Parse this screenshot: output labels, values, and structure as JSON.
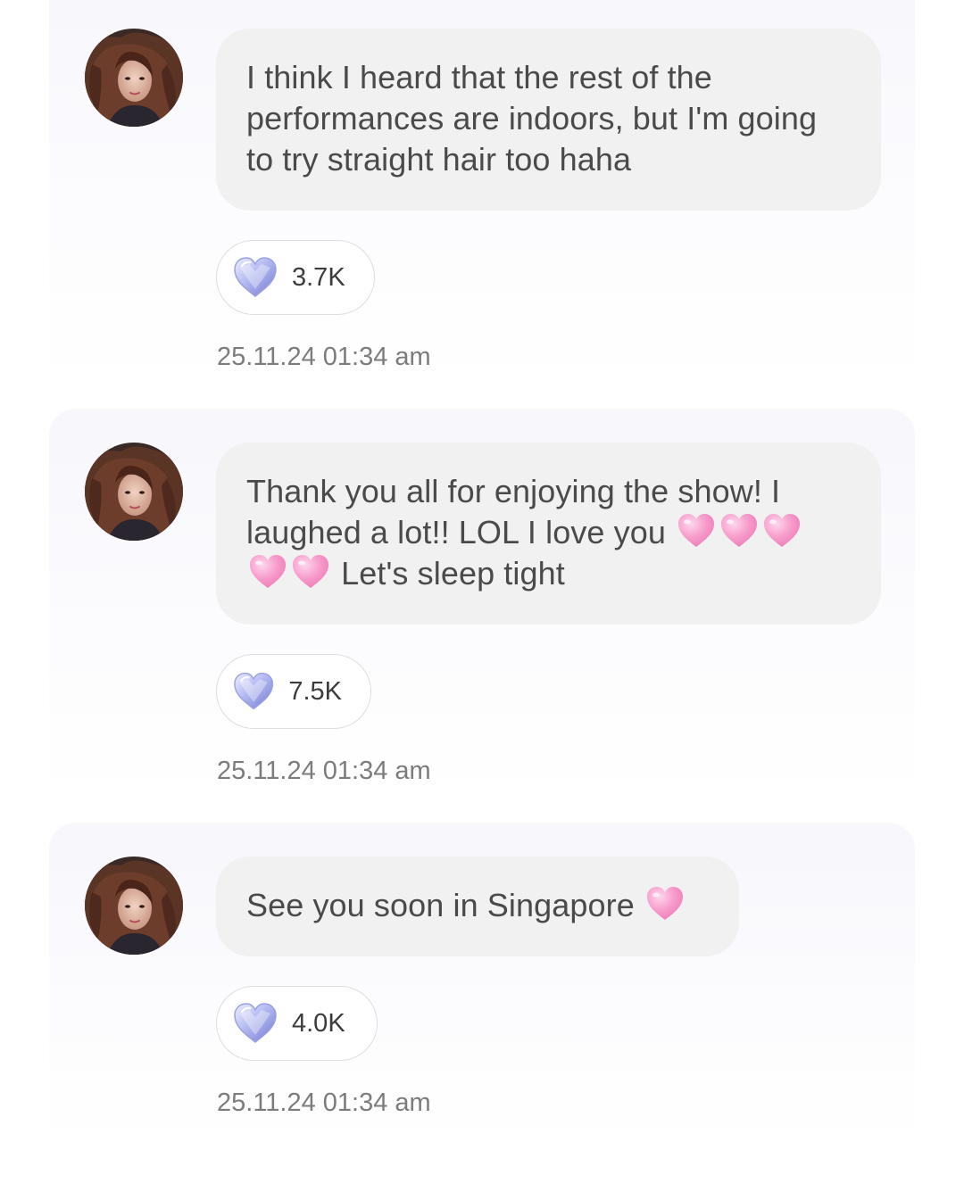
{
  "messages": [
    {
      "text_segments": [
        "I think I heard that the rest of the performances are indoors, but I'm going to try straight hair too haha"
      ],
      "reaction_count": "3.7K",
      "timestamp": "25.11.24 01:34 am"
    },
    {
      "text_segments": [
        "Thank you all for enjoying the show! I laughed a lot!! LOL I love you ",
        " Let's sleep tight"
      ],
      "reaction_count": "7.5K",
      "timestamp": "25.11.24 01:34 am"
    },
    {
      "text_segments": [
        "See you soon in Singapore "
      ],
      "reaction_count": "4.0K",
      "timestamp": "25.11.24 01:34 am"
    }
  ],
  "icons": {
    "reaction": "crystal-heart-icon",
    "inline_emoji": "pink-heart-emoji"
  },
  "colors": {
    "bubble_bg": "#f1f1f1",
    "bubble_text": "#4a4a4a",
    "timestamp_text": "#7c7c7c",
    "pink_heart": "#f58fc3",
    "crystal_heart": "#b8bff0"
  }
}
